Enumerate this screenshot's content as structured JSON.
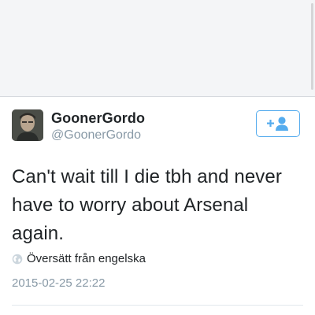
{
  "tweet": {
    "display_name": "GoonerGordo",
    "handle": "@GoonerGordo",
    "text": "Can't wait till I die tbh and never have to worry about Arsenal again.",
    "translate_label": "Översätt från engelska",
    "timestamp": "2015-02-25 22:22"
  },
  "icons": {
    "follow": "add-user-icon",
    "translate": "globe-icon"
  },
  "colors": {
    "accent": "#55acee",
    "text": "#1f2326",
    "secondary_text": "#8899a6",
    "top_background": "#f4f5f7"
  }
}
